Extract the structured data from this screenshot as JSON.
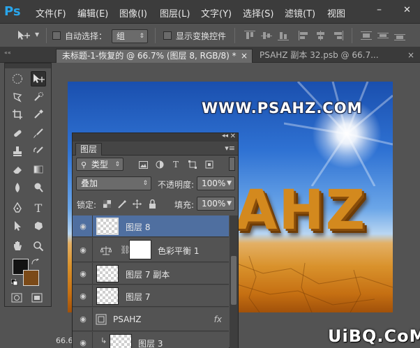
{
  "app": {
    "logo": "Ps"
  },
  "menu": [
    {
      "label": "文件(F)"
    },
    {
      "label": "编辑(E)"
    },
    {
      "label": "图像(I)"
    },
    {
      "label": "图层(L)"
    },
    {
      "label": "文字(Y)"
    },
    {
      "label": "选择(S)"
    },
    {
      "label": "滤镜(T)"
    },
    {
      "label": "视图"
    }
  ],
  "window_controls": {
    "minimize": "–",
    "close": "✕"
  },
  "options": {
    "tool_icon": "move-tool-icon",
    "auto_select_label": "自动选择：",
    "auto_select_value": "组",
    "show_transform_label": "显示变换控件"
  },
  "tabs": [
    {
      "label": "未标题-1-恢复的 @ 66.7% (图层 8, RGB/8) *",
      "close": "×",
      "active": true
    },
    {
      "label": "PSAHZ 副本 32.psb @ 66.7...",
      "close": "×",
      "active": false
    }
  ],
  "canvas": {
    "watermark": "WWW.PSAHZ.COM",
    "art_text": "AHZ",
    "zoom_readout": "66.6"
  },
  "layers_panel": {
    "tab_label": "图层",
    "filter_type": "类型",
    "blend_mode": "叠加",
    "opacity_label": "不透明度:",
    "opacity_value": "100%",
    "lock_label": "锁定:",
    "fill_label": "填充:",
    "fill_value": "100%",
    "layers": [
      {
        "name": "图层 8",
        "selected": true,
        "kind": "pixel"
      },
      {
        "name": "色彩平衡 1",
        "selected": false,
        "kind": "adjustment"
      },
      {
        "name": "图层 7 副本",
        "selected": false,
        "kind": "pixel"
      },
      {
        "name": "图层 7",
        "selected": false,
        "kind": "pixel"
      },
      {
        "name": "PSAHZ",
        "selected": false,
        "kind": "smart",
        "fx": "fx"
      },
      {
        "name": "图层 3",
        "selected": false,
        "kind": "pixel"
      }
    ]
  },
  "site_mark": "UiBQ.CoM",
  "colors": {
    "accent": "#29a6ec",
    "selected_layer": "#4f6fa0",
    "foreground": "#121212",
    "background": "#7b4a18"
  }
}
